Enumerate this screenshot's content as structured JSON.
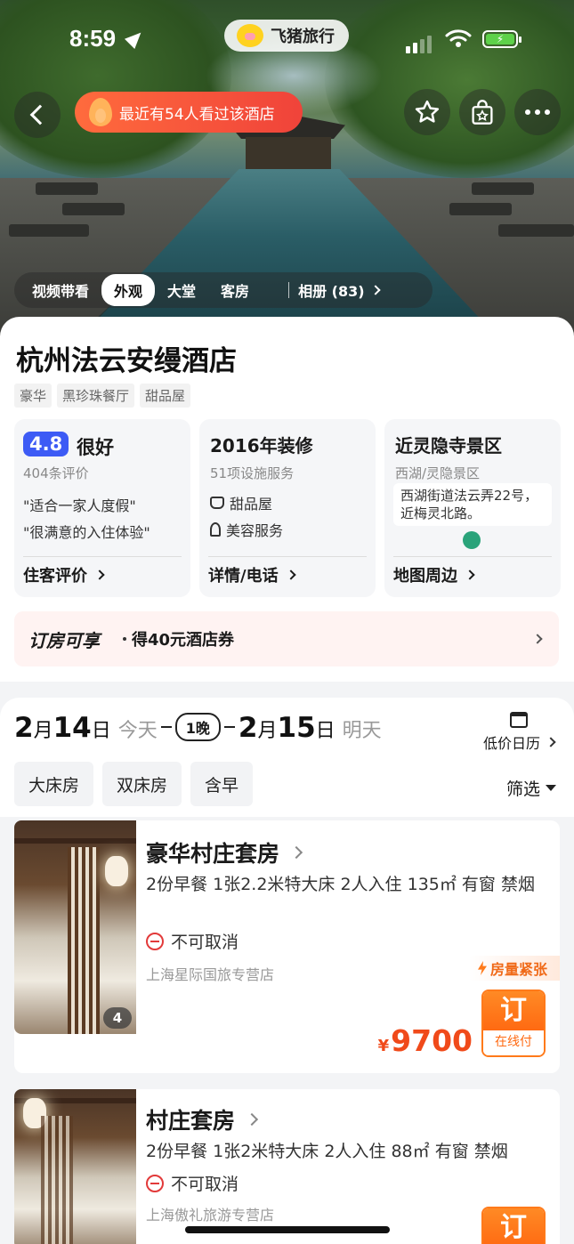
{
  "status_bar": {
    "time": "8:59"
  },
  "brand": {
    "name": "飞猪旅行"
  },
  "hero": {
    "viewers_text": "最近有54人看过该酒店",
    "gallery_tabs": [
      "视频带看",
      "外观",
      "大堂",
      "客房"
    ],
    "active_tab": "外观",
    "album_label": "相册 (83)"
  },
  "hotel": {
    "name": "杭州法云安缦酒店",
    "tags": [
      "豪华",
      "黑珍珠餐厅",
      "甜品屋"
    ]
  },
  "review_card": {
    "score": "4.8",
    "score_word": "很好",
    "count": "404条评价",
    "quotes": [
      "\"适合一家人度假\"",
      "\"很满意的入住体验\""
    ],
    "link": "住客评价"
  },
  "facility_card": {
    "title": "2016年装修",
    "sub": "51项设施服务",
    "items": [
      "甜品屋",
      "美容服务"
    ],
    "link": "详情/电话"
  },
  "location_card": {
    "title": "近灵隐寺景区",
    "sub": "西湖/灵隐景区",
    "address": "西湖街道法云弄22号， 近梅灵北路。",
    "link": "地图周边"
  },
  "promo": {
    "label": "订房可享",
    "text": "得40元酒店券"
  },
  "dates": {
    "checkin_month": "2",
    "checkin_day": "14",
    "checkin_word": "今天",
    "nights": "1晚",
    "checkout_month": "2",
    "checkout_day": "15",
    "checkout_word": "明天",
    "month_unit": "月",
    "day_unit": "日",
    "calendar_label": "低价日历"
  },
  "filters": {
    "chips": [
      "大床房",
      "双床房",
      "含早"
    ],
    "filter_label": "筛选"
  },
  "rooms": [
    {
      "title": "豪华村庄套房",
      "desc": "2份早餐  1张2.2米特大床  2人入住  135㎡  有窗  禁烟",
      "cancel": "不可取消",
      "seller": "上海星际国旅专营店",
      "badge": "房量紧张",
      "photo_count": "4",
      "currency": "¥",
      "price": "9700",
      "book": "订",
      "pay": "在线付"
    },
    {
      "title": "村庄套房",
      "desc": "2份早餐  1张2米特大床  2人入住  88㎡  有窗  禁烟",
      "cancel": "不可取消",
      "seller": "上海傲礼旅游专营店",
      "book": "订"
    }
  ],
  "colors": {
    "accent": "#ff6a12",
    "score": "#3d5bf5",
    "price": "#f04a1a"
  }
}
